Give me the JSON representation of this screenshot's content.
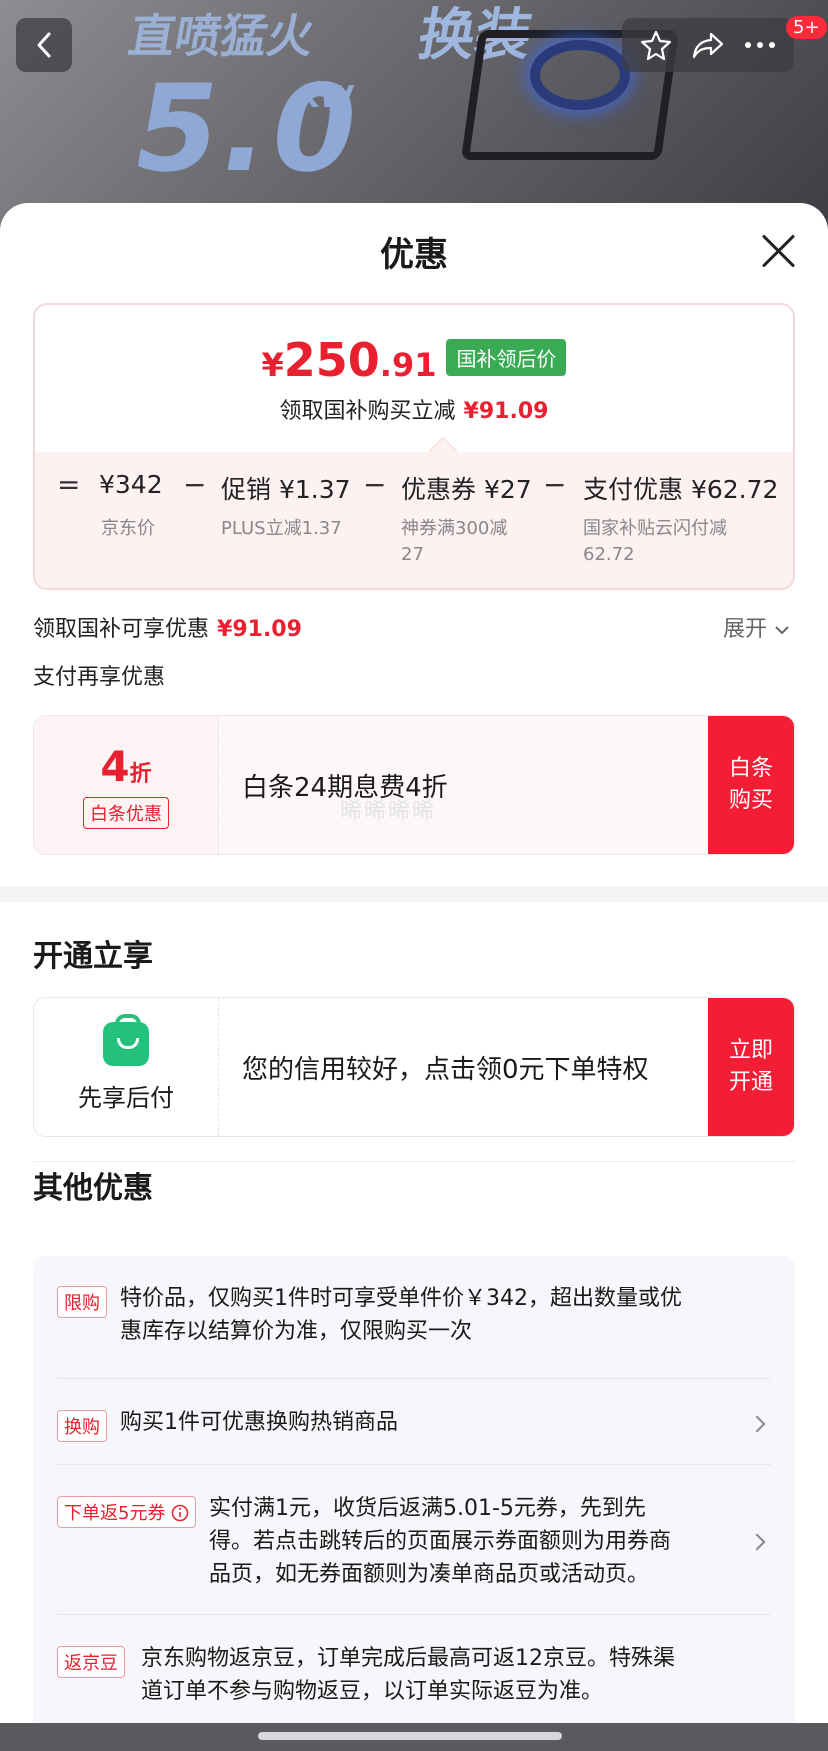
{
  "backdrop": {
    "promo_line1": "直喷猛火",
    "promo_value": "5.0",
    "promo_unit": "kW",
    "promo_right": "换装"
  },
  "nav": {
    "back_icon": "chevron-left-icon",
    "badge": "5+",
    "icons": [
      "star-icon",
      "share-icon",
      "more-icon"
    ]
  },
  "sheet": {
    "title": "优惠"
  },
  "price": {
    "yen": "¥",
    "integer": "250",
    "decimal": ".91",
    "tag": "国补领后价",
    "sub_label": "领取国补购买立减",
    "sub_value": "¥91.09",
    "equals": "=",
    "minus": "−",
    "items": [
      {
        "label": "¥342",
        "sub": "京东价"
      },
      {
        "label": "促销 ¥1.37",
        "sub": "PLUS立减1.37"
      },
      {
        "label": "优惠券 ¥27",
        "sub": "神券满300减",
        "sub2": "27"
      },
      {
        "label": "支付优惠 ¥62.72",
        "sub": "国家补贴云闪付减",
        "sub2": "62.72"
      }
    ]
  },
  "subsidy": {
    "label": "领取国补可享优惠",
    "value": "¥91.09",
    "expand": "展开"
  },
  "pay_section": {
    "label": "支付再享优惠"
  },
  "baitiao": {
    "discount_num": "4",
    "discount_unit": "折",
    "tag": "白条优惠",
    "desc": "白条24期息费4折",
    "button": "白条购买",
    "watermark": "晞晞晞晞"
  },
  "open_section": {
    "title": "开通立享",
    "left_label": "先享后付",
    "desc": "您的信用较好，点击领0元下单特权",
    "button": "立即开通"
  },
  "other_section": {
    "title": "其他优惠",
    "items": [
      {
        "tag": "限购",
        "text_line1": "特价品，仅购买1件时可享受单件价￥342，超出数量或优",
        "text_line2": "惠库存以结算价为准，仅限购买一次"
      },
      {
        "tag": "换购",
        "text_line1": "购买1件可优惠换购热销商品"
      },
      {
        "tag": "下单返5元券",
        "text_line1": "实付满1元，收货后返满5.01-5元券，先到先",
        "text_line2": "得。若点击跳转后的页面展示券面额则为用券商",
        "text_line3": "品页，如无券面额则为凑单商品页或活动页。"
      },
      {
        "tag": "返京豆",
        "text_line1": "京东购物返京豆，订单完成后最高可返12京豆。特殊渠",
        "text_line2": "道订单不参与购物返豆，以订单实际返豆为准。"
      }
    ]
  },
  "colors": {
    "accent_red": "#f31d35",
    "price_red": "#e8202f",
    "green_tag": "#3aaa54",
    "bag_green": "#23c27c"
  }
}
